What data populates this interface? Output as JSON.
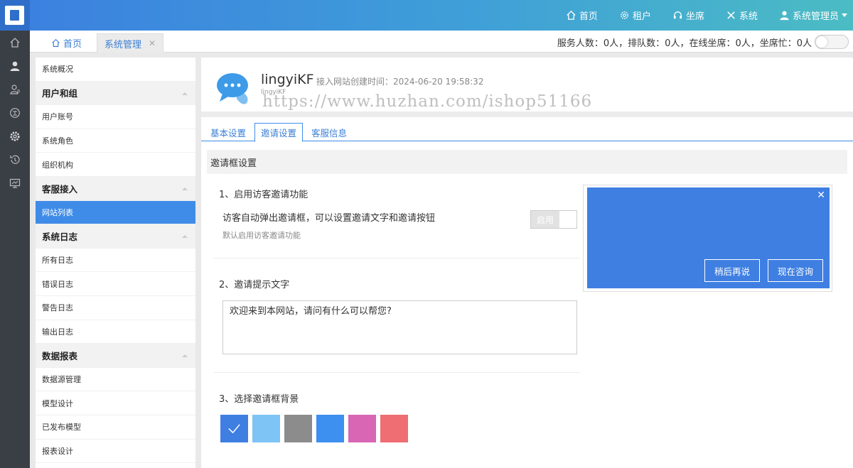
{
  "top_nav": {
    "items": [
      {
        "label": "首页",
        "icon": "home-icon"
      },
      {
        "label": "租户",
        "icon": "gear-icon"
      },
      {
        "label": "坐席",
        "icon": "headset-icon"
      },
      {
        "label": "系统",
        "icon": "tools-icon"
      },
      {
        "label": "系统管理员",
        "icon": "user-icon"
      }
    ]
  },
  "rail": {
    "icons": [
      "home-icon",
      "user-icon",
      "contacts-icon",
      "knowledge-icon",
      "gear-icon",
      "history-icon",
      "monitor-icon"
    ]
  },
  "tabs": {
    "home_label": "首页",
    "active_label": "系统管理",
    "close_glyph": "✕"
  },
  "status_bar": {
    "text": "服务人数：0人，排队数：0人，在线坐席：0人，坐席忙：0人"
  },
  "menu": {
    "items": [
      {
        "label": "系统概况",
        "type": "item"
      },
      {
        "label": "用户和组",
        "type": "group"
      },
      {
        "label": "用户账号",
        "type": "item"
      },
      {
        "label": "系统角色",
        "type": "item"
      },
      {
        "label": "组织机构",
        "type": "item"
      },
      {
        "label": "客服接入",
        "type": "group"
      },
      {
        "label": "网站列表",
        "type": "item",
        "active": true
      },
      {
        "label": "系统日志",
        "type": "group"
      },
      {
        "label": "所有日志",
        "type": "item"
      },
      {
        "label": "错误日志",
        "type": "item"
      },
      {
        "label": "警告日志",
        "type": "item"
      },
      {
        "label": "输出日志",
        "type": "item"
      },
      {
        "label": "数据报表",
        "type": "group"
      },
      {
        "label": "数据源管理",
        "type": "item"
      },
      {
        "label": "模型设计",
        "type": "item"
      },
      {
        "label": "已发布模型",
        "type": "item"
      },
      {
        "label": "报表设计",
        "type": "item"
      }
    ]
  },
  "site": {
    "name": "lingyiKF",
    "created": "接入网站创建时间：2024-06-20 19:58:32",
    "subtitle": "lingyiKF",
    "watermark": "https://www.huzhan.com/ishop51166"
  },
  "sub_tabs": [
    "基本设置",
    "邀请设置",
    "客服信息"
  ],
  "section_title": "邀请框设置",
  "form": {
    "q1_title": "1、启用访客邀请功能",
    "q1_text": "访客自动弹出邀请框，可以设置邀请文字和邀请按钮",
    "q1_hint": "默认启用访客邀请功能",
    "switch_label": "启用",
    "q2_title": "2、邀请提示文字",
    "invite_text": "欢迎来到本网站，请问有什么可以帮您?",
    "q3_title": "3、选择邀请框背景",
    "colors": [
      "#3f7fe2",
      "#7ec4f5",
      "#8c8c8c",
      "#3d8ff0",
      "#d866b4",
      "#ee6e73"
    ],
    "selected_color_index": 0
  },
  "preview": {
    "close_glyph": "✕",
    "later_button": "稍后再说",
    "consult_button": "现在咨询"
  }
}
